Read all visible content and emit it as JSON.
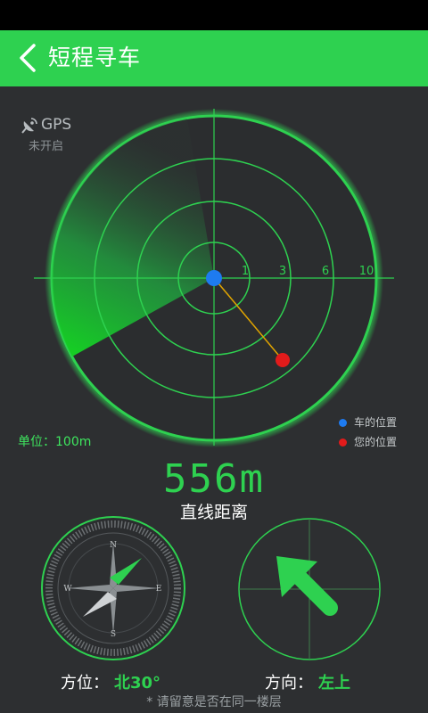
{
  "header": {
    "title": "短程寻车"
  },
  "gps": {
    "label": "GPS",
    "status": "未开启"
  },
  "radar": {
    "ring_labels": [
      "1",
      "3",
      "6",
      "10"
    ],
    "unit": "单位：100m",
    "legend": {
      "car": "车的位置",
      "you": "您的位置"
    },
    "colors": {
      "accent": "#2ed150",
      "car_dot": "#1e7bf0",
      "you_dot": "#e21b1b"
    }
  },
  "distance": {
    "value": "556m",
    "label": "直线距离"
  },
  "compass": {
    "labels": [
      "N",
      "E",
      "S",
      "W"
    ],
    "orientation_label": "方位：",
    "orientation_value": "北30°"
  },
  "direction": {
    "label": "方向：",
    "value": "左上"
  },
  "hint": "* 请留意是否在同一楼层"
}
